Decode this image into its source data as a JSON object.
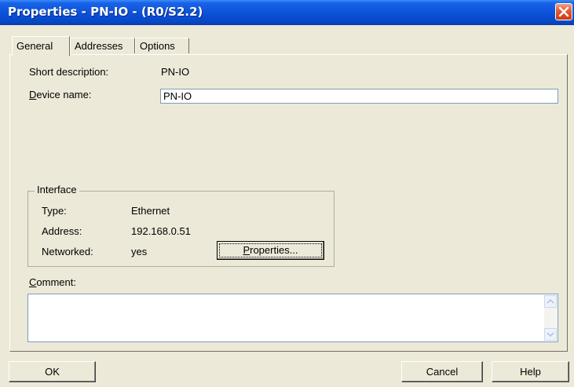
{
  "window": {
    "title": "Properties - PN-IO - (R0/S2.2)"
  },
  "tabs": [
    {
      "label": "General",
      "active": true
    },
    {
      "label": "Addresses",
      "active": false
    },
    {
      "label": "Options",
      "active": false
    }
  ],
  "general": {
    "short_description_label": "Short description:",
    "short_description_value": "PN-IO",
    "device_name_label_underlined": "D",
    "device_name_label_rest": "evice name:",
    "device_name_value": "PN-IO"
  },
  "interface": {
    "title": "Interface",
    "type_label": "Type:",
    "type_value": "Ethernet",
    "address_label": "Address:",
    "address_value": "192.168.0.51",
    "networked_label": "Networked:",
    "networked_value": "yes",
    "properties_button_underlined": "P",
    "properties_button_rest": "roperties..."
  },
  "comment": {
    "label_underlined": "C",
    "label_rest": "omment:",
    "value": ""
  },
  "buttons": {
    "ok": "OK",
    "cancel": "Cancel",
    "help": "Help"
  },
  "colors": {
    "titlebar": "#0a50d8",
    "dialog_bg": "#ece9d8",
    "close_button": "#e05a32"
  }
}
